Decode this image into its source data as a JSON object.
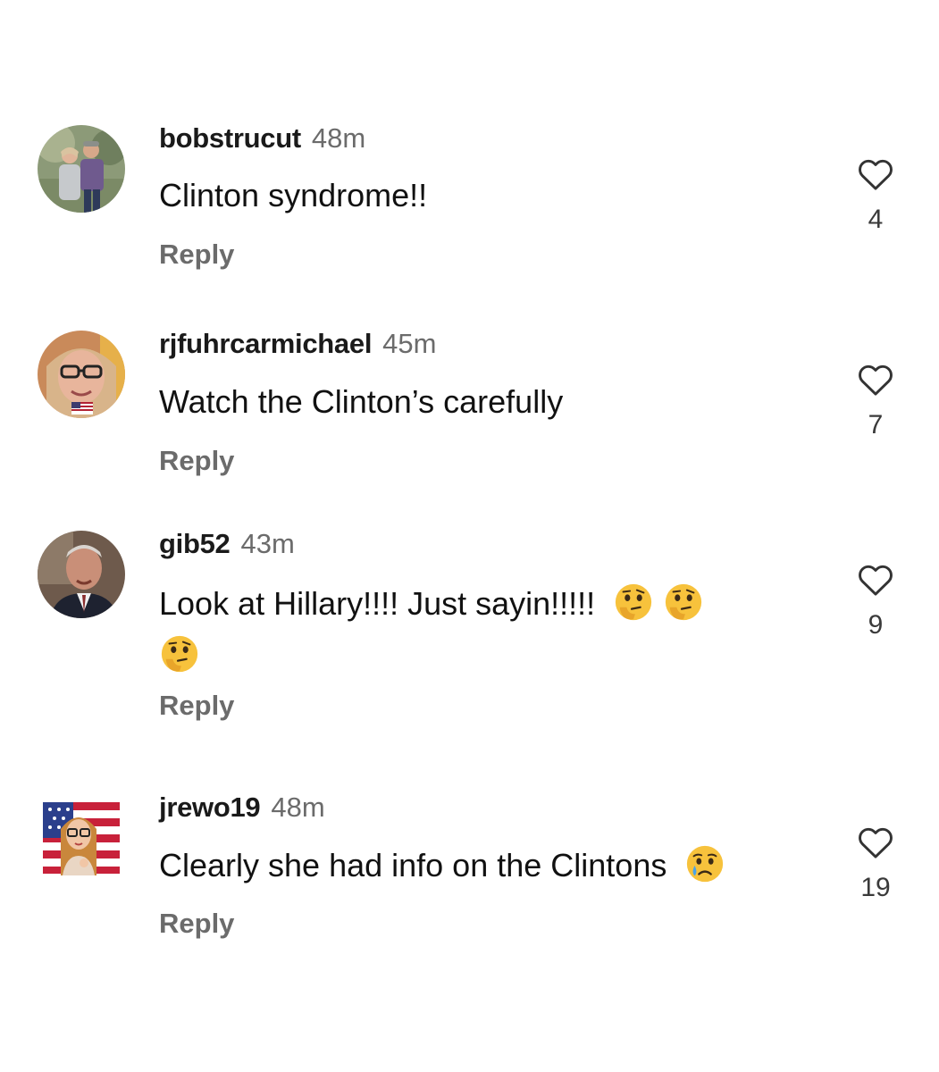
{
  "comments": [
    {
      "username": "bobstrucut",
      "time": "48m",
      "text": "Clinton syndrome!!",
      "reply_label": "Reply",
      "likes": "4",
      "avatar": "avatar-couple-photo"
    },
    {
      "username": "rjfuhrcarmichael",
      "time": "45m",
      "text": "Watch the Clinton’s carefully",
      "reply_label": "Reply",
      "likes": "7",
      "avatar": "avatar-woman-glasses-photo"
    },
    {
      "username": "gib52",
      "time": "43m",
      "text_line1": "Look at Hillary!!!! Just sayin!!!!!",
      "emojis": [
        "thinking-face-emoji",
        "thinking-face-emoji",
        "thinking-face-emoji"
      ],
      "reply_label": "Reply",
      "likes": "9",
      "avatar": "avatar-man-suit-photo"
    },
    {
      "username": "jrewo19",
      "time": "48m",
      "text": "Clearly she had info on the Clintons",
      "emojis": [
        "sad-but-relieved-face-emoji"
      ],
      "reply_label": "Reply",
      "likes": "19",
      "avatar": "avatar-bitmoji-flag"
    }
  ],
  "icons": {
    "like": "heart-outline-icon"
  },
  "colors": {
    "background": "#ffffff",
    "username": "#1a1a1a",
    "secondary_text": "#6b6b6b",
    "emoji_yellow": "#f7c23c"
  }
}
